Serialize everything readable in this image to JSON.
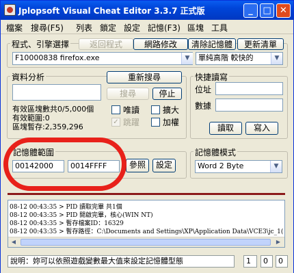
{
  "title": "Jplopsoft Visual Cheat Editor 3.3.7 正式版",
  "window_buttons": {
    "minimize": "_",
    "maximize": "□",
    "close": "✕"
  },
  "menu": [
    "檔案",
    "搜尋(F5)",
    "列表",
    "鎖定",
    "設定",
    "記憶(F3)",
    "區塊",
    "工具"
  ],
  "process_group": {
    "label": "程式、引擎選擇",
    "tabs": [
      "返回程式",
      "網路修改",
      "清除記憶體",
      "更新清單"
    ],
    "process_value": "F10000838 firefox.exe",
    "engine_value": "單純高階 較快的"
  },
  "analysis": {
    "label": "資料分析",
    "research_button": "重新搜尋",
    "search_button": "搜尋",
    "stop_button": "停止",
    "stats": [
      "有效區塊數共0/5,000個",
      "有效範圍:0",
      "區塊暫存:2,359,296"
    ],
    "checkboxes": [
      {
        "label": "唯讀",
        "checked": false,
        "enabled": true
      },
      {
        "label": "擴大",
        "checked": false,
        "enabled": true
      },
      {
        "label": "跳躍",
        "checked": true,
        "enabled": false
      },
      {
        "label": "加權",
        "checked": false,
        "enabled": true
      }
    ]
  },
  "quick_read": {
    "label": "快捷讀寫",
    "addr_label": "位址",
    "value_label": "數據",
    "read_button": "讀取",
    "write_button": "寫入"
  },
  "memory_range": {
    "label": "記憶體範圍",
    "start": "00142000",
    "end": "0014FFFF",
    "ref_button": "參照",
    "set_button": "設定"
  },
  "memory_mode": {
    "label": "記憶體模式",
    "value": "Word 2 Byte"
  },
  "log": [
    "08-12 00:43:35 > PID 讀取完畢 共1個",
    "08-12 00:43:35 > PID 開啟完畢，核心(WIN NT)",
    "08-12 00:43:35 > 暫存檔案ID：16329",
    "08-12 00:43:35 > 暫存路徑：C:\\Documents and Settings\\XP\\Application Data\\VCE3\\jc_1("
  ],
  "status": {
    "hint": "說明：妳可以依照遊戲變數最大值來設定記憶體型態",
    "field1": "1",
    "field2": "0",
    "field3": "0"
  },
  "colors": {
    "title_blue": "#0045d8",
    "annotation_red": "#e8211a"
  }
}
